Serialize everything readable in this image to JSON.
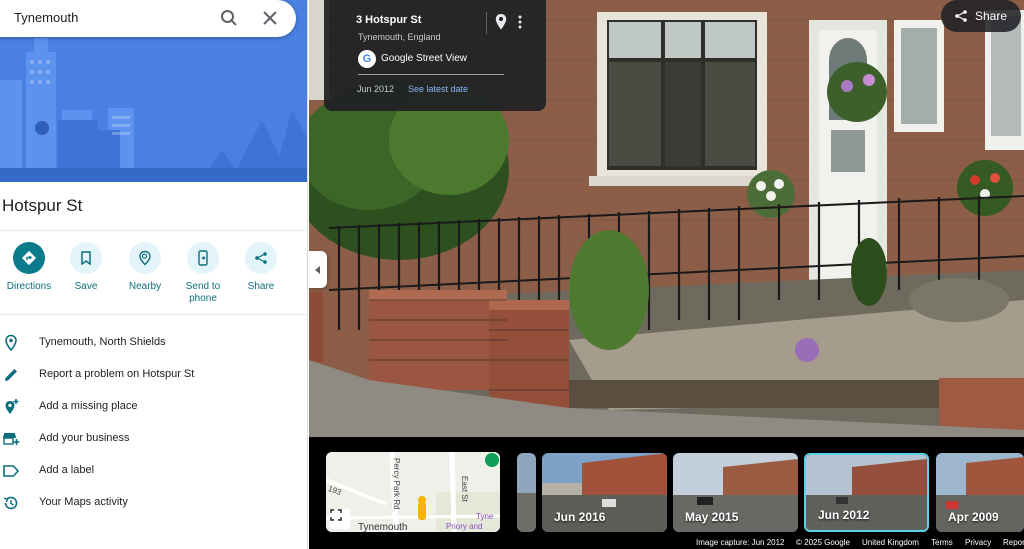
{
  "search": {
    "value": "Tynemouth"
  },
  "place": {
    "title": "Hotspur St"
  },
  "actions": [
    {
      "label": "Directions"
    },
    {
      "label": "Save"
    },
    {
      "label": "Nearby"
    },
    {
      "label": "Send to phone"
    },
    {
      "label": "Share"
    }
  ],
  "info": [
    {
      "icon": "location-pin-icon",
      "text": "Tynemouth, North Shields"
    },
    {
      "icon": "pencil-icon",
      "text": "Report a problem on Hotspur St"
    },
    {
      "icon": "add-place-icon",
      "text": "Add a missing place"
    },
    {
      "icon": "store-icon",
      "text": "Add your business"
    },
    {
      "icon": "label-icon",
      "text": "Add a label"
    },
    {
      "icon": "history-icon",
      "text": "Your Maps activity"
    }
  ],
  "street_view": {
    "address": "3 Hotspur St",
    "subtitle": "Tynemouth, England",
    "provider": "Google Street View",
    "capture_date": "Jun 2012",
    "latest_link": "See latest date"
  },
  "share_button": "Share",
  "minimap": {
    "road1": "Percy Park Rd",
    "road2": "East St",
    "road3": "193",
    "place1": "Tynemouth",
    "place2": "Tyne",
    "place3": "Priory and"
  },
  "timeline": [
    {
      "label": "Jun 2016"
    },
    {
      "label": "May 2015"
    },
    {
      "label": "Jun 2012"
    },
    {
      "label": "Apr 2009"
    }
  ],
  "footer": {
    "capture": "Image capture: Jun 2012",
    "copyright": "© 2025 Google",
    "region": "United Kingdom",
    "terms": "Terms",
    "privacy": "Privacy",
    "report": "Report"
  }
}
